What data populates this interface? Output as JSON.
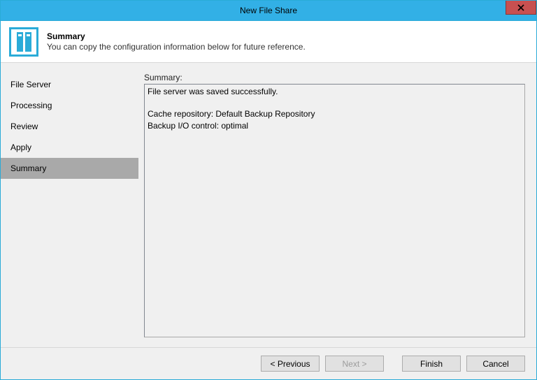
{
  "window": {
    "title": "New File Share"
  },
  "header": {
    "title": "Summary",
    "description": "You can copy the configuration information below for future reference."
  },
  "sidebar": {
    "items": [
      {
        "label": "File Server",
        "selected": false
      },
      {
        "label": "Processing",
        "selected": false
      },
      {
        "label": "Review",
        "selected": false
      },
      {
        "label": "Apply",
        "selected": false
      },
      {
        "label": "Summary",
        "selected": true
      }
    ]
  },
  "main": {
    "summary_label": "Summary:",
    "summary_text": "File server was saved successfully.\n\nCache repository: Default Backup Repository\nBackup I/O control: optimal"
  },
  "footer": {
    "previous": "< Previous",
    "next": "Next >",
    "finish": "Finish",
    "cancel": "Cancel",
    "next_enabled": false
  }
}
